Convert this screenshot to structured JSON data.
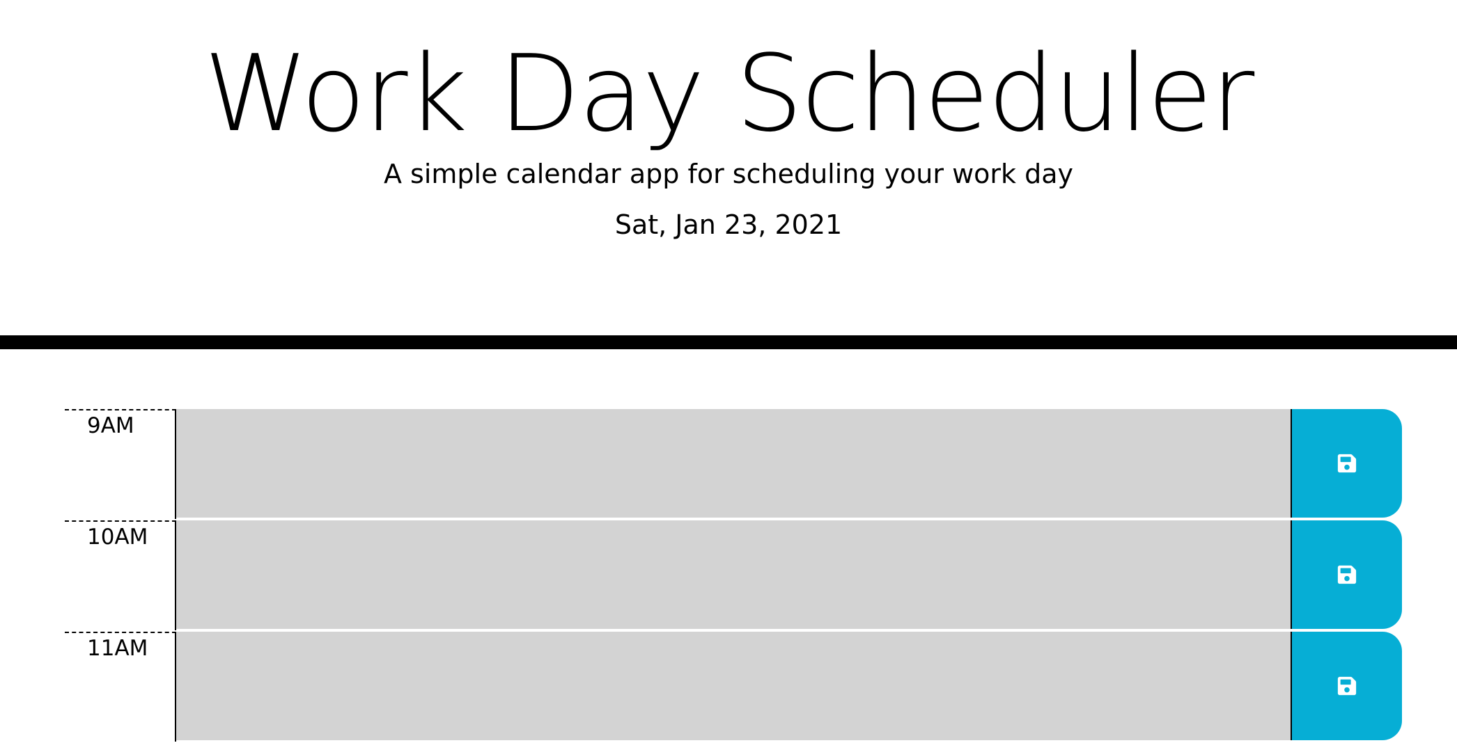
{
  "header": {
    "title": "Work Day Scheduler",
    "subtitle": "A simple calendar app for scheduling your work day",
    "current_day": "Sat, Jan 23, 2021"
  },
  "time_blocks": [
    {
      "hour": "9AM",
      "event": "",
      "save_icon": "save-icon"
    },
    {
      "hour": "10AM",
      "event": "",
      "save_icon": "save-icon"
    },
    {
      "hour": "11AM",
      "event": "",
      "save_icon": "save-icon"
    }
  ],
  "colors": {
    "past_block": "#d3d3d3",
    "save_button": "#06aed5",
    "divider": "#000000"
  }
}
